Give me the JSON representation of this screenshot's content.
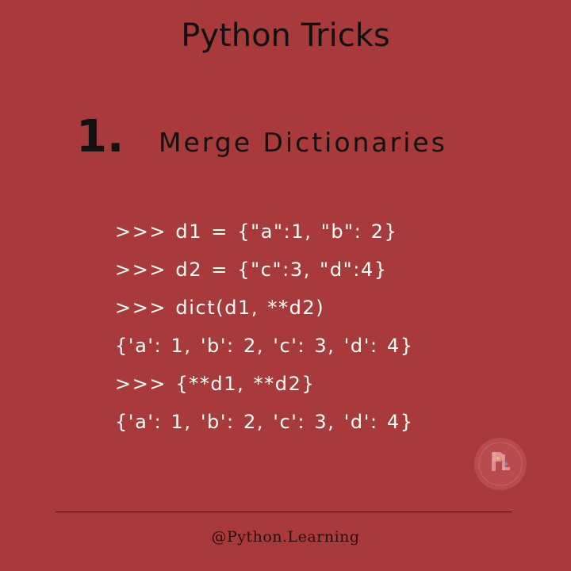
{
  "header": {
    "title": "Python Tricks"
  },
  "section": {
    "number": "1.",
    "title": "Merge Dictionaries"
  },
  "code": {
    "lines": [
      ">>> d1 = {\"a\":1, \"b\": 2}",
      ">>> d2 = {\"c\":3, \"d\":4}",
      ">>> dict(d1, **d2)",
      "{'a': 1, 'b': 2, 'c': 3, 'd': 4}",
      ">>> {**d1, **d2}",
      "{'a': 1, 'b': 2, 'c': 3, 'd': 4}"
    ]
  },
  "watermark": {
    "icon": "python-learning-logo-icon"
  },
  "footer": {
    "handle": "@Python.Learning"
  },
  "colors": {
    "background": "#a83a3c",
    "heading": "#111111",
    "code_text": "#ffffff"
  }
}
